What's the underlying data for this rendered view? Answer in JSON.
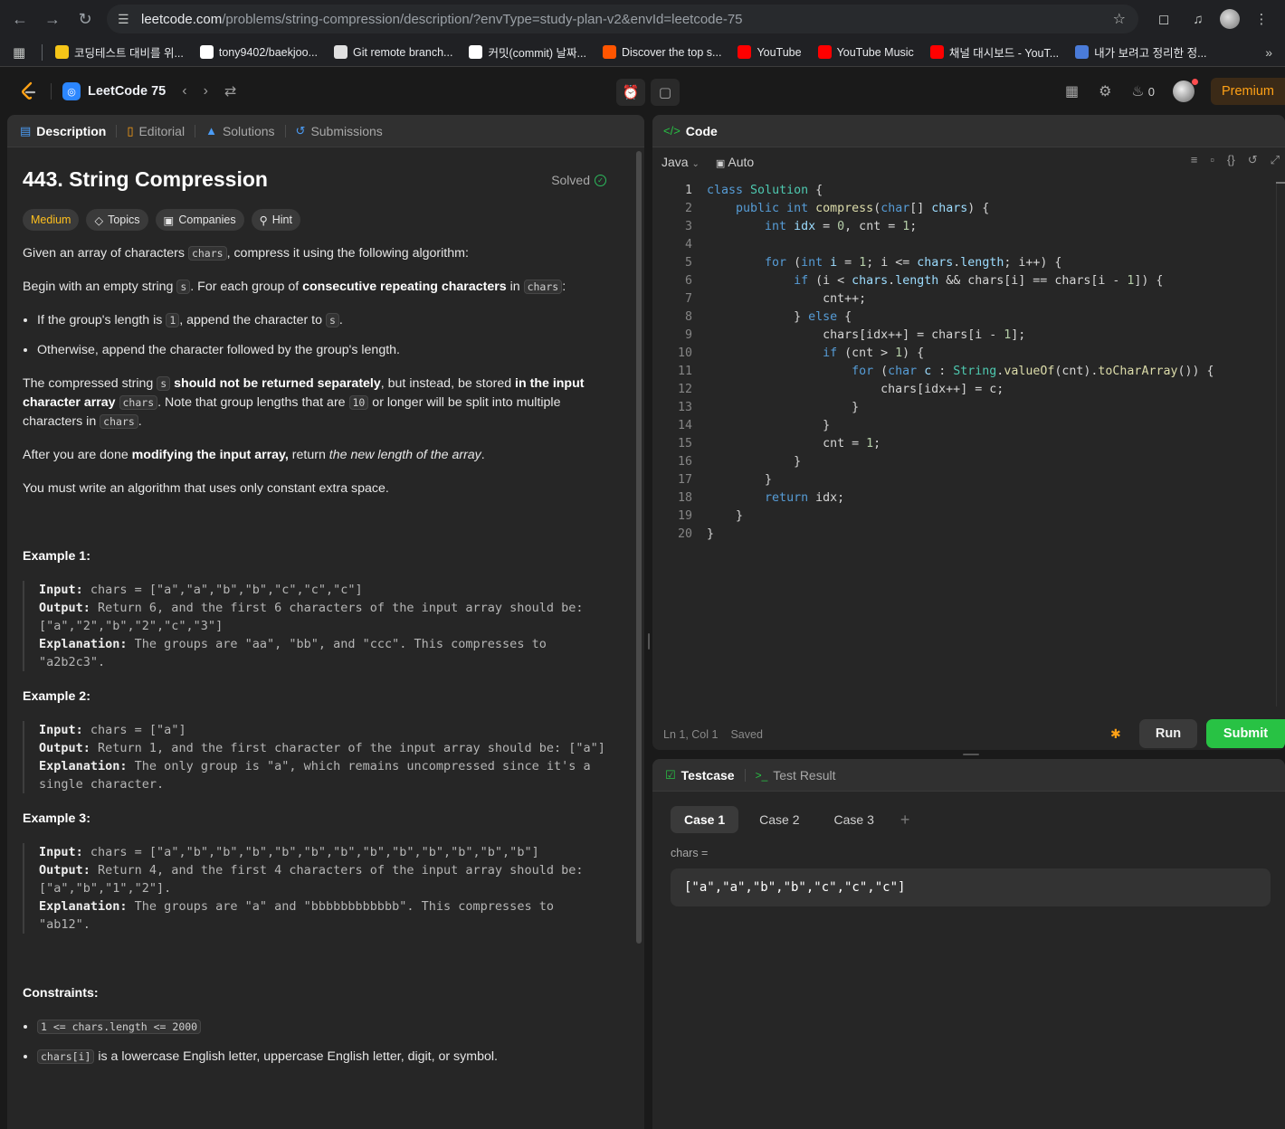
{
  "browser": {
    "url_host": "leetcode.com",
    "url_path": "/problems/string-compression/description/?envType=study-plan-v2&envId=leetcode-75",
    "bookmarks": [
      {
        "label": "코딩테스트 대비를 위...",
        "color": "#f5c518"
      },
      {
        "label": "tony9402/baekjoo...",
        "color": "#ffffff"
      },
      {
        "label": "Git remote branch...",
        "color": "#e0e0e0"
      },
      {
        "label": "커밋(commit) 날짜...",
        "color": "#ffffff"
      },
      {
        "label": "Discover the top s...",
        "color": "#ff5500"
      },
      {
        "label": "YouTube",
        "color": "#ff0000"
      },
      {
        "label": "YouTube Music",
        "color": "#ff0000"
      },
      {
        "label": "채널 대시보드 - YouT...",
        "color": "#ff0000"
      },
      {
        "label": "내가 보려고 정리한 정...",
        "color": "#4a7bd8"
      }
    ]
  },
  "nav": {
    "study_plan": "LeetCode 75",
    "fire_count": "0",
    "premium": "Premium"
  },
  "tabs": {
    "description": "Description",
    "editorial": "Editorial",
    "solutions": "Solutions",
    "submissions": "Submissions"
  },
  "problem": {
    "title": "443. String Compression",
    "status": "Solved",
    "difficulty": "Medium",
    "tag_topics": "Topics",
    "tag_companies": "Companies",
    "tag_hint": "Hint"
  },
  "code_panel": {
    "title": "Code",
    "language": "Java",
    "mode": "Auto",
    "cursor": "Ln 1, Col 1",
    "saved": "Saved",
    "run": "Run",
    "submit": "Submit"
  },
  "testcase": {
    "tab_testcase": "Testcase",
    "tab_result": "Test Result",
    "cases": [
      "Case 1",
      "Case 2",
      "Case 3"
    ],
    "param_label": "chars =",
    "param_value": "[\"a\",\"a\",\"b\",\"b\",\"c\",\"c\",\"c\"]"
  },
  "colors": {
    "accent": "#ffa116",
    "submit": "#28c244",
    "medium": "#ffc01e"
  }
}
